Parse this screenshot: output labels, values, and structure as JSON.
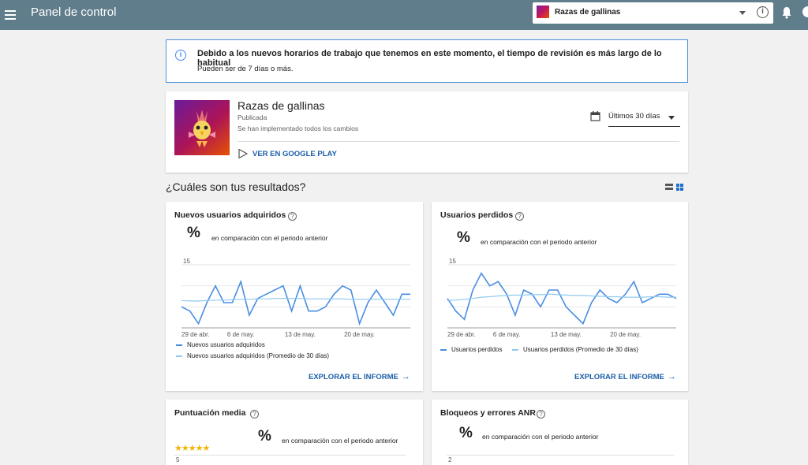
{
  "topbar": {
    "title": "Panel de control",
    "app_selector": "Razas de gallinas"
  },
  "notice": {
    "line1": "Debido a los nuevos horarios de trabajo que tenemos en este momento, el tiempo de revisión es más largo de lo habitual",
    "line2": "Pueden ser de 7 días o más."
  },
  "app": {
    "name": "Razas de gallinas",
    "status": "Publicada",
    "changes": "Se han implementado todos los cambios",
    "play_link": "VER EN GOOGLE PLAY",
    "range": "Últimos 30 días"
  },
  "results": {
    "title": "¿Cuáles son tus resultados?"
  },
  "colors": {
    "series": "#4a8de0",
    "average": "#8fcaf0",
    "accent": "#1a5fa8",
    "topbar": "#607d8b"
  },
  "cards": [
    {
      "title": "Nuevos usuarios adquiridos",
      "percent": "%",
      "comparison": "en comparación con el periodo anterior",
      "explore": "EXPLORAR EL INFORME",
      "legend": [
        "Nuevos usuarios adquiridos",
        "Nuevos usuarios adquiridos (Promedio de 30 días)"
      ]
    },
    {
      "title": "Usuarios perdidos",
      "percent": "%",
      "comparison": "en comparación con el periodo anterior",
      "explore": "EXPLORAR EL INFORME",
      "legend": [
        "Usuarios perdidos",
        "Usuarios perdidos (Promedio de 30 días)"
      ]
    },
    {
      "title": "Puntuación media",
      "percent": "%",
      "comparison": "en comparación con el periodo anterior",
      "y_tick": "5",
      "stars": "★★★★★"
    },
    {
      "title": "Bloqueos y errores ANR",
      "percent": "%",
      "comparison": "en comparación con el periodo anterior",
      "y_tick": "2"
    }
  ],
  "chart_data": [
    {
      "type": "line",
      "x_ticks": [
        "29 de abr.",
        "6 de may.",
        "13 de may.",
        "20 de may."
      ],
      "y_tick": "15",
      "ylim": [
        0,
        15
      ],
      "series": [
        {
          "name": "Nuevos usuarios adquiridos",
          "values": [
            5,
            4,
            1,
            6,
            10,
            6,
            6,
            11,
            3,
            7,
            8,
            9,
            10,
            4,
            10,
            4,
            4,
            5,
            8,
            10,
            9,
            1,
            6,
            9,
            6,
            3,
            8,
            8
          ]
        },
        {
          "name": "Nuevos usuarios adquiridos (Promedio de 30 días)",
          "values": [
            6.5,
            6.4,
            6.4,
            6.5,
            6.6,
            6.6,
            6.7,
            6.8,
            6.8,
            6.9,
            6.9,
            7,
            7,
            7,
            7,
            6.9,
            6.9,
            6.9,
            6.9,
            6.9,
            6.8,
            6.8,
            6.8,
            6.8,
            6.8,
            6.8,
            6.8,
            6.8
          ]
        }
      ]
    },
    {
      "type": "line",
      "x_ticks": [
        "29 de abr.",
        "6 de may.",
        "13 de may.",
        "20 de may."
      ],
      "y_tick": "15",
      "ylim": [
        0,
        15
      ],
      "series": [
        {
          "name": "Usuarios perdidos",
          "values": [
            7,
            4,
            2,
            9,
            13,
            10,
            11,
            8,
            3,
            9,
            8,
            5,
            9,
            9,
            5,
            3,
            1,
            6,
            9,
            7,
            6,
            8,
            11,
            6,
            7,
            8,
            8,
            7
          ]
        },
        {
          "name": "Usuarios perdidos (Promedio de 30 días)",
          "values": [
            6.5,
            6.6,
            6.8,
            7,
            7.3,
            7.4,
            7.6,
            7.7,
            7.8,
            7.8,
            7.9,
            7.9,
            8,
            7.9,
            7.8,
            7.7,
            7.7,
            7.6,
            7.5,
            7.4,
            7.4,
            7.3,
            7.3,
            7.3,
            7.4,
            7.4,
            7.3,
            7.3
          ]
        }
      ]
    }
  ]
}
